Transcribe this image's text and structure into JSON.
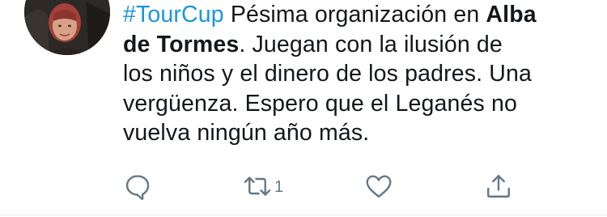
{
  "tweet": {
    "hashtag": "#TourCup",
    "text_part1": " Pésima organización en ",
    "bold_line1": "Alba",
    "bold_line2": "de Tormes",
    "text_part2": ".  Juegan con la ilusión de",
    "line3": "los niños y el dinero de los padres. Una",
    "line4": "vergüenza.  Espero que el Leganés no",
    "line5": "vuelva ningún año más."
  },
  "actions": {
    "reply_icon": "reply-icon",
    "retweet_icon": "retweet-icon",
    "retweet_count": "1",
    "like_icon": "heart-icon",
    "share_icon": "share-icon"
  },
  "colors": {
    "text": "#14171a",
    "hashtag": "#1b95e0",
    "icon": "#657786"
  }
}
